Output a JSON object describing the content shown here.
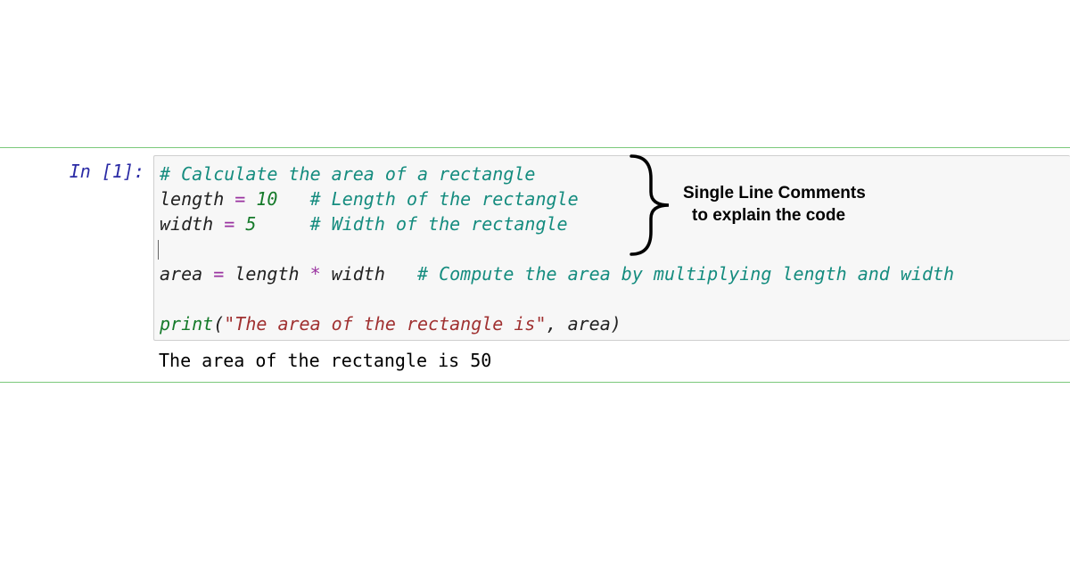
{
  "prompt": "In [1]:",
  "code": {
    "line1": "# Calculate the area of a rectangle",
    "line2_var": "length",
    "line2_eq": " = ",
    "line2_num": "10",
    "line2_sp": "   ",
    "line2_comment": "# Length of the rectangle",
    "line3_var": "width",
    "line3_eq": " = ",
    "line3_num": "5",
    "line3_sp": "     ",
    "line3_comment": "# Width of the rectangle",
    "line5_var": "area",
    "line5_eq": " = ",
    "line5_expr1": "length",
    "line5_op": " * ",
    "line5_expr2": "width",
    "line5_sp": "   ",
    "line5_comment": "# Compute the area by multiplying length and width",
    "line7_fn": "print",
    "line7_paren1": "(",
    "line7_str": "\"The area of the rectangle is\"",
    "line7_comma": ", ",
    "line7_arg": "area",
    "line7_paren2": ")"
  },
  "output": "The area of the rectangle is 50",
  "annotation": {
    "line1": "Single Line Comments",
    "line2": "to explain the code"
  }
}
